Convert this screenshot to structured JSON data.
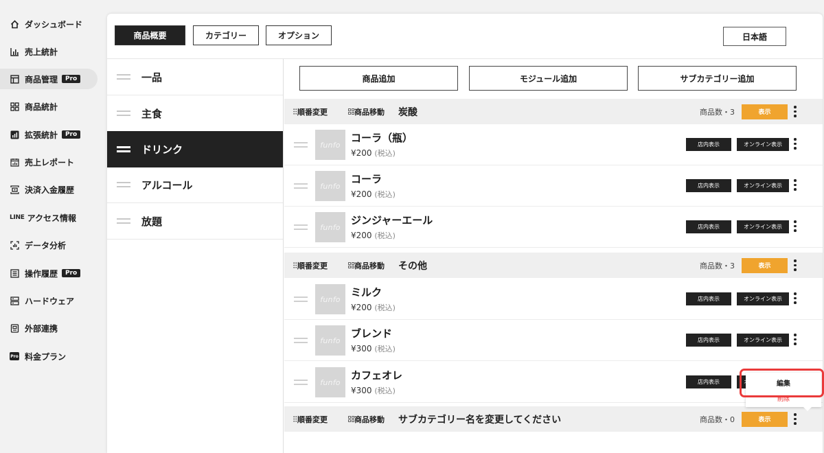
{
  "sidebar": {
    "items": [
      {
        "label": "ダッシュボード",
        "icon": "home-icon",
        "pro": false,
        "active": false
      },
      {
        "label": "売上統計",
        "icon": "bar-chart-icon",
        "pro": false,
        "active": false
      },
      {
        "label": "商品管理",
        "icon": "layout-icon",
        "pro": true,
        "active": true
      },
      {
        "label": "商品統計",
        "icon": "grid-icon",
        "pro": false,
        "active": false
      },
      {
        "label": "拡張統計",
        "icon": "chart-box-icon",
        "pro": true,
        "active": false
      },
      {
        "label": "売上レポート",
        "icon": "report-icon",
        "pro": false,
        "active": false
      },
      {
        "label": "決済入金履歴",
        "icon": "payment-icon",
        "pro": false,
        "active": false
      },
      {
        "label": "アクセス情報",
        "icon": "line-icon",
        "pro": false,
        "active": false
      },
      {
        "label": "データ分析",
        "icon": "analysis-icon",
        "pro": false,
        "active": false
      },
      {
        "label": "操作履歴",
        "icon": "list-icon",
        "pro": true,
        "active": false
      },
      {
        "label": "ハードウェア",
        "icon": "hardware-icon",
        "pro": false,
        "active": false
      },
      {
        "label": "外部連携",
        "icon": "integration-icon",
        "pro": false,
        "active": false
      },
      {
        "label": "料金プラン",
        "icon": "pro-icon",
        "pro": false,
        "active": false
      }
    ],
    "pro_label": "Pro",
    "line_logo": "LINE",
    "pro_icon_text": "Pro"
  },
  "tabs": [
    {
      "label": "商品概要",
      "active": true
    },
    {
      "label": "カテゴリー",
      "active": false
    },
    {
      "label": "オプション",
      "active": false
    }
  ],
  "language": "日本語",
  "categories": [
    {
      "label": "一品",
      "active": false
    },
    {
      "label": "主食",
      "active": false
    },
    {
      "label": "ドリンク",
      "active": true
    },
    {
      "label": "アルコール",
      "active": false
    },
    {
      "label": "放題",
      "active": false
    }
  ],
  "actions": {
    "add_product": "商品追加",
    "add_module": "モジュール追加",
    "add_subcategory": "サブカテゴリー追加"
  },
  "labels": {
    "reorder": "順番変更",
    "move": "商品移動",
    "count_prefix": "商品数・",
    "show": "表示",
    "store_display": "店内表示",
    "online_display": "オンライン表示",
    "tax": "(税込)",
    "thumb_text": "funfo"
  },
  "subcategories": [
    {
      "name": "炭酸",
      "count": "3"
    },
    {
      "name": "その他",
      "count": "3"
    },
    {
      "name": "サブカテゴリー名を変更してください",
      "count": "0"
    }
  ],
  "products": [
    {
      "name": "コーラ（瓶）",
      "price": "¥200"
    },
    {
      "name": "コーラ",
      "price": "¥200"
    },
    {
      "name": "ジンジャーエール",
      "price": "¥200"
    },
    {
      "name": "ミルク",
      "price": "¥200"
    },
    {
      "name": "ブレンド",
      "price": "¥300"
    },
    {
      "name": "カフェオレ",
      "price": "¥300"
    }
  ],
  "popup": {
    "edit": "編集",
    "delete": "削除"
  }
}
